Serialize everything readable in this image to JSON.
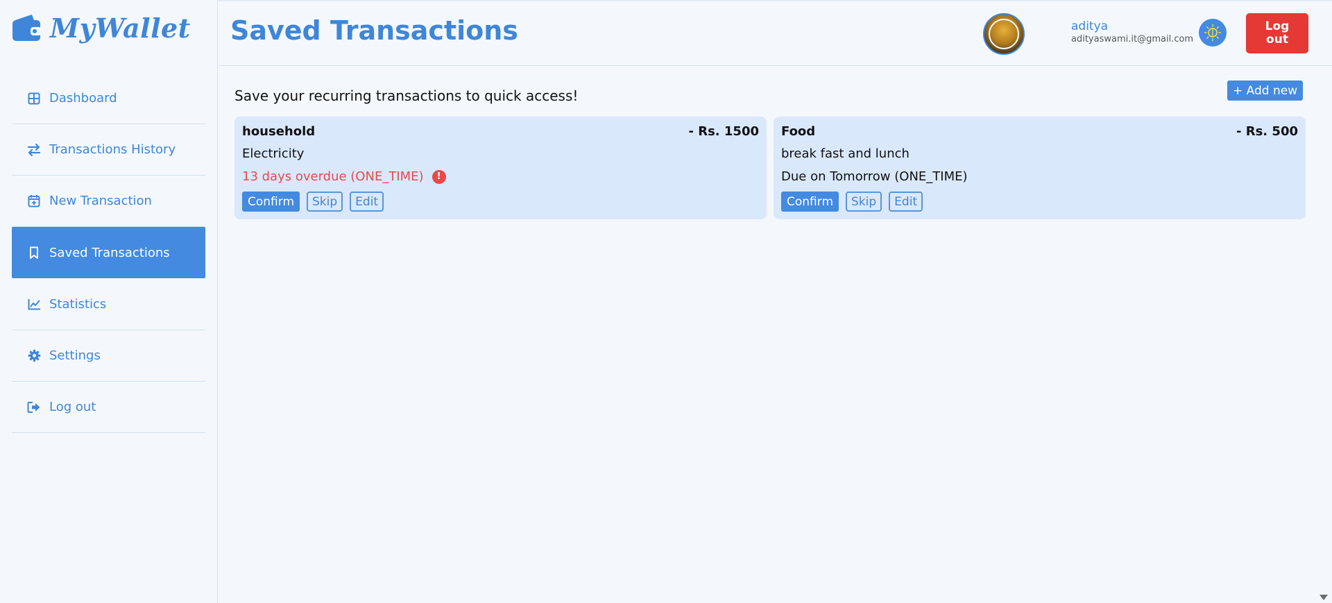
{
  "app": {
    "brand": "MyWallet"
  },
  "sidebar": {
    "items": [
      {
        "label": "Dashboard",
        "icon": "grid-icon"
      },
      {
        "label": "Transactions History",
        "icon": "arrows-exchange-icon"
      },
      {
        "label": "New Transaction",
        "icon": "calendar-plus-icon"
      },
      {
        "label": "Saved Transactions",
        "icon": "bookmark-icon",
        "active": true
      },
      {
        "label": "Statistics",
        "icon": "line-chart-icon"
      },
      {
        "label": "Settings",
        "icon": "gear-icon"
      },
      {
        "label": "Log out",
        "icon": "sign-out-icon"
      }
    ]
  },
  "header": {
    "title": "Saved Transactions",
    "user": {
      "name": "aditya",
      "email": "adityaswami.it@gmail.com"
    },
    "logout_label": "Log out"
  },
  "main": {
    "intro": "Save your recurring transactions to quick access!",
    "add_new_label": "+ Add new",
    "cards": [
      {
        "category": "household",
        "amount": "- Rs. 1500",
        "description": "Electricity",
        "due": "13 days overdue (ONE_TIME)",
        "overdue": true,
        "confirm": "Confirm",
        "skip": "Skip",
        "edit": "Edit"
      },
      {
        "category": "Food",
        "amount": "- Rs. 500",
        "description": "break fast and lunch",
        "due": "Due on Tomorrow (ONE_TIME)",
        "overdue": false,
        "confirm": "Confirm",
        "skip": "Skip",
        "edit": "Edit"
      }
    ]
  },
  "colors": {
    "accent": "#438ae0",
    "brand_text": "#3f86d9",
    "danger": "#e53935",
    "overdue_text": "#e84a4a",
    "card_bg": "#d9e8fb"
  }
}
